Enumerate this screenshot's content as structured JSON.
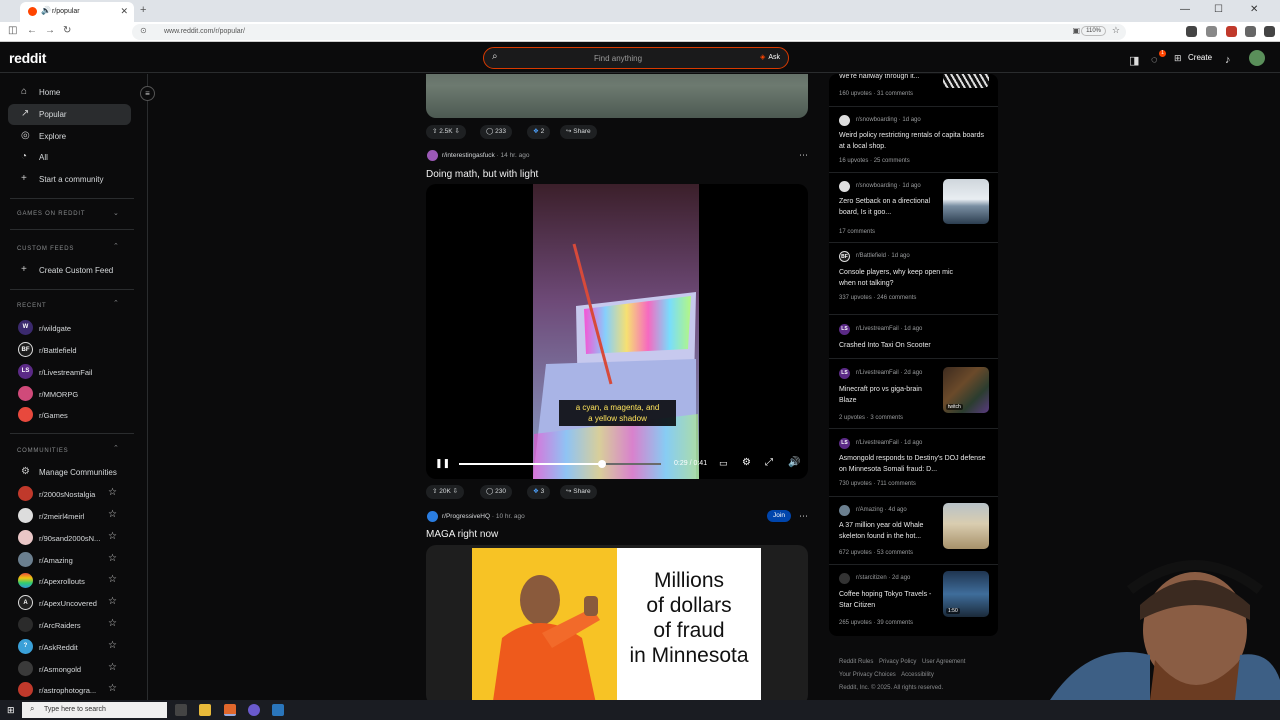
{
  "browser": {
    "tab_title": "r/popular",
    "sound_icon": "🔊",
    "close_glyph": "✕",
    "new_tab_glyph": "+",
    "url": "www.reddit.com/r/popular/",
    "zoom": "110%",
    "window_controls": [
      "—",
      "☐",
      "✕"
    ]
  },
  "header": {
    "logo": "reddit",
    "search_placeholder": "Find anything",
    "ask_label": "Ask",
    "create_label": "Create",
    "notification_count": "1"
  },
  "sidebar": {
    "nav": [
      {
        "label": "Home",
        "icon": "home-icon",
        "glyph": "⌂"
      },
      {
        "label": "Popular",
        "icon": "popular-icon",
        "glyph": "↗"
      },
      {
        "label": "Explore",
        "icon": "explore-icon",
        "glyph": "◎"
      },
      {
        "label": "All",
        "icon": "all-icon",
        "glyph": "◔"
      },
      {
        "label": "Start a community",
        "icon": "plus-icon",
        "glyph": "+"
      }
    ],
    "games_section": "GAMES ON REDDIT",
    "custom_feeds_section": "CUSTOM FEEDS",
    "create_custom_feed": "Create Custom Feed",
    "recent_section": "RECENT",
    "recent": [
      {
        "name": "r/wildgate",
        "badge": "W",
        "color": "#3b2a6e"
      },
      {
        "name": "r/Battlefield",
        "badge": "BF",
        "color": "#1c1c1c"
      },
      {
        "name": "r/LivestreamFail",
        "badge": "LS",
        "color": "#5b2a86"
      },
      {
        "name": "r/MMORPG",
        "badge": "",
        "color": "#d04a7a"
      },
      {
        "name": "r/Games",
        "badge": "",
        "color": "#e8493d"
      }
    ],
    "communities_section": "COMMUNITIES",
    "manage_communities": "Manage Communities",
    "communities": [
      {
        "name": "r/2000sNostalgia",
        "badge": "",
        "color": "#c0392b"
      },
      {
        "name": "r/2meirl4meirl",
        "badge": "",
        "color": "#dddddd"
      },
      {
        "name": "r/90sand2000sN...",
        "badge": "",
        "color": "#e9c6c6"
      },
      {
        "name": "r/Amazing",
        "badge": "",
        "color": "#6b7f8f"
      },
      {
        "name": "r/Apexrollouts",
        "badge": "",
        "color": "#e67e22"
      },
      {
        "name": "r/ApexUncovered",
        "badge": "A",
        "color": "#202020"
      },
      {
        "name": "r/ArcRaiders",
        "badge": "",
        "color": "#2b2b2b"
      },
      {
        "name": "r/AskReddit",
        "badge": "?",
        "color": "#3aa0d8"
      },
      {
        "name": "r/Asmongold",
        "badge": "",
        "color": "#3a3a3a"
      },
      {
        "name": "r/astrophotogra...",
        "badge": "",
        "color": "#c0392b"
      }
    ]
  },
  "feed": {
    "post1": {
      "votes": "2.5K",
      "comments": "233",
      "awards": "2",
      "share": "Share"
    },
    "post2": {
      "subreddit": "r/interestingasfuck",
      "time": "14 hr. ago",
      "title": "Doing math, but with light",
      "caption_line1": "a cyan, a magenta, and",
      "caption_line2": "a yellow shadow",
      "time_display": "0:29 / 0:41",
      "progress": 0.71,
      "votes": "20K",
      "comments": "230",
      "awards": "3",
      "share": "Share"
    },
    "post3": {
      "subreddit": "r/ProgressiveHQ",
      "time": "10 hr. ago",
      "join": "Join",
      "title": "MAGA right now",
      "meme_line1": "Millions",
      "meme_line2": "of dollars",
      "meme_line3": "of fraud",
      "meme_line4": "in Minnesota"
    }
  },
  "right_sidebar": {
    "items": [
      {
        "title": "We're halfway through it...",
        "stats": "160 upvotes · 31 comments"
      },
      {
        "sub": "r/snowboarding",
        "time": "1d ago",
        "title": "Weird policy restricting rentals of capita boards at a local shop.",
        "stats": "16 upvotes · 25 comments"
      },
      {
        "sub": "r/snowboarding",
        "time": "1d ago",
        "title": "Zero Setback on a directional board, Is it goo...",
        "stats": "17 comments"
      },
      {
        "sub": "r/Battlefield",
        "time": "1d ago",
        "title": "Console players, why keep open mic when not talking?",
        "stats": "337 upvotes · 246 comments"
      },
      {
        "sub": "r/LivestreamFail",
        "time": "1d ago",
        "title": "Crashed Into Taxi On Scooter",
        "stats": ""
      },
      {
        "sub": "r/LivestreamFail",
        "time": "2d ago",
        "title": "Minecraft pro vs giga-brain Blaze",
        "stats": "2 upvotes · 3 comments",
        "thumb_label": "twitch"
      },
      {
        "sub": "r/LivestreamFail",
        "time": "1d ago",
        "title": "Asmongold responds to Destiny's DOJ defense on Minnesota Somali fraud: D...",
        "stats": "730 upvotes · 711 comments"
      },
      {
        "sub": "r/Amazing",
        "time": "4d ago",
        "title": "A 37 million year old Whale skeleton found in the hot...",
        "stats": "672 upvotes · 53 comments"
      },
      {
        "sub": "r/starcitizen",
        "time": "2d ago",
        "title": "Coffee hoping Tokyo Travels - Star Citizen",
        "stats": "265 upvotes · 39 comments",
        "thumb_label": "1:50"
      }
    ]
  },
  "footer": {
    "links1": [
      "Reddit Rules",
      "Privacy Policy",
      "User Agreement"
    ],
    "links2": [
      "Your Privacy Choices",
      "Accessibility"
    ],
    "copyright": "Reddit, Inc. © 2025. All rights reserved."
  },
  "taskbar": {
    "search_placeholder": "Type here to search"
  }
}
